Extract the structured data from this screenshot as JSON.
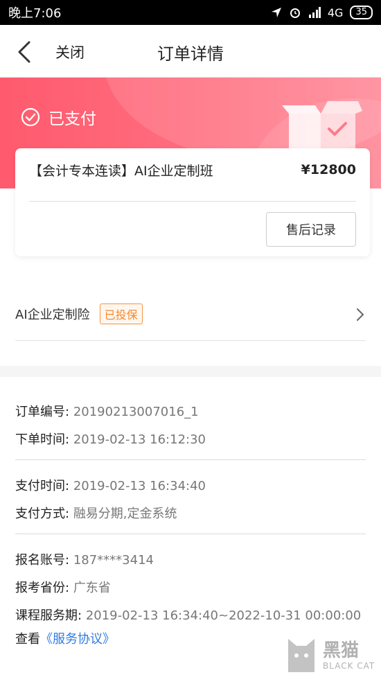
{
  "status_bar": {
    "time": "晚上7:06",
    "network": "4G",
    "battery": "35"
  },
  "nav": {
    "close_label": "关闭",
    "title": "订单详情"
  },
  "banner": {
    "status_text": "已支付"
  },
  "order_card": {
    "course_name": "【会计专本连读】AI企业定制班",
    "price": "¥12800",
    "after_sales_label": "售后记录"
  },
  "insurance": {
    "label": "AI企业定制险",
    "tag": "已投保"
  },
  "details": {
    "order_no_label": "订单编号:",
    "order_no": "20190213007016_1",
    "order_time_label": "下单时间:",
    "order_time": "2019-02-13 16:12:30",
    "pay_time_label": "支付时间:",
    "pay_time": "2019-02-13 16:34:40",
    "pay_method_label": "支付方式:",
    "pay_method": "融易分期,定金系统",
    "account_label": "报名账号:",
    "account": "187****3414",
    "province_label": "报考省份:",
    "province": "广东省",
    "service_period_label": "课程服务期:",
    "service_period": "2019-02-13 16:34:40~2022-10-31 00:00:00",
    "view_label": "查看",
    "agreement_link": "《服务协议》"
  },
  "watermark": {
    "cn": "黑猫",
    "en": "BLACK CAT"
  },
  "colors": {
    "banner": "#ff5a6e",
    "tag": "#f28a30",
    "link": "#2f7be0"
  }
}
